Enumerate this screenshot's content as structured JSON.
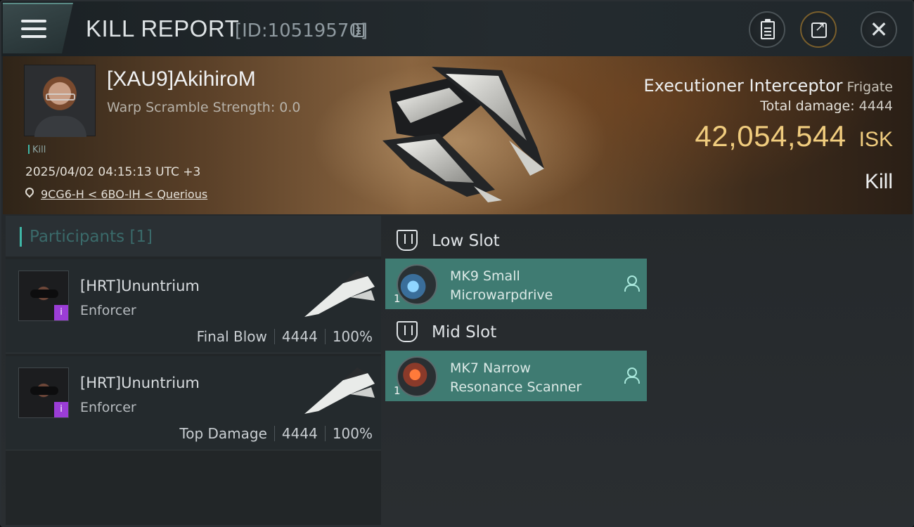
{
  "header": {
    "title": "KILL REPORT",
    "kill_id": "[ID:10519570]"
  },
  "victim": {
    "name": "[XAU9]AkihiroM",
    "warp_scramble": "Warp Scramble Strength: 0.0",
    "tag": "Kill",
    "datetime": "2025/04/02 04:15:13 UTC +3",
    "location": "9CG6-H < 6BO-IH < Querious",
    "ship_name": "Executioner Interceptor",
    "ship_class": "Frigate",
    "total_damage_label": "Total damage:",
    "total_damage": "4444",
    "isk_value": "42,054,544",
    "isk_currency": "ISK",
    "result": "Kill"
  },
  "participants": {
    "header": "Participants [1]",
    "rows": [
      {
        "name": "[HRT]Ununtrium",
        "ship": "Enforcer",
        "role": "Final Blow",
        "damage": "4444",
        "percent": "100%"
      },
      {
        "name": "[HRT]Ununtrium",
        "ship": "Enforcer",
        "role": "Top Damage",
        "damage": "4444",
        "percent": "100%"
      }
    ]
  },
  "slots": {
    "low": {
      "label": "Low Slot",
      "module": {
        "qty": "1",
        "line1": "MK9 Small",
        "line2": "Microwarpdrive"
      }
    },
    "mid": {
      "label": "Mid Slot",
      "module": {
        "qty": "1",
        "line1": "MK7 Narrow",
        "line2": "Resonance Scanner"
      }
    }
  },
  "colors": {
    "accent_teal": "#3fb7a7",
    "isk_gold": "#f0cc7e",
    "module_bg": "#3f7b72",
    "badge_purple": "#9b3dd6"
  },
  "icons": {
    "menu": "hamburger-icon",
    "copy": "copy-icon",
    "clipboard": "clipboard-icon",
    "share": "share-icon",
    "close": "close-icon",
    "location": "map-pin-icon",
    "slot": "slot-shield-icon",
    "user": "user-icon"
  }
}
